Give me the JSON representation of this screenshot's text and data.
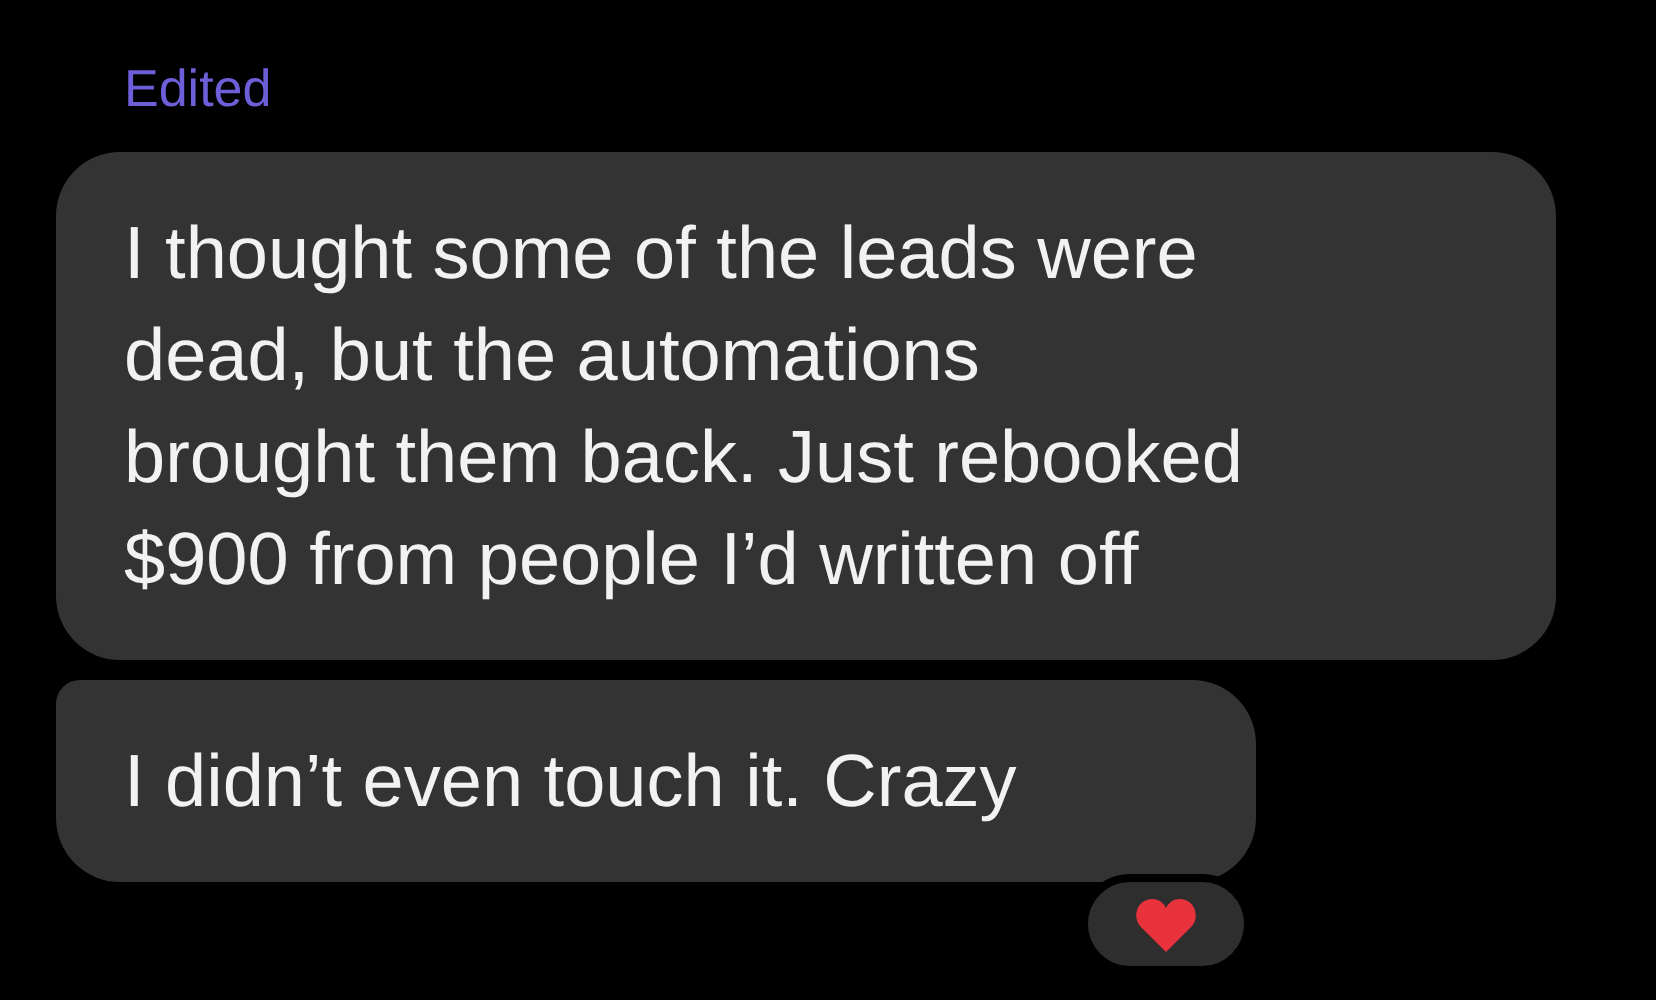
{
  "edited_label": "Edited",
  "messages": [
    {
      "lines": [
        "I thought some of the leads were",
        "dead, but the automations",
        "brought them back. Just rebooked",
        "$900 from people I’d written off"
      ]
    },
    {
      "lines": [
        "I didn’t even touch it. Crazy"
      ],
      "reaction": {
        "kind": "heart"
      }
    }
  ]
}
